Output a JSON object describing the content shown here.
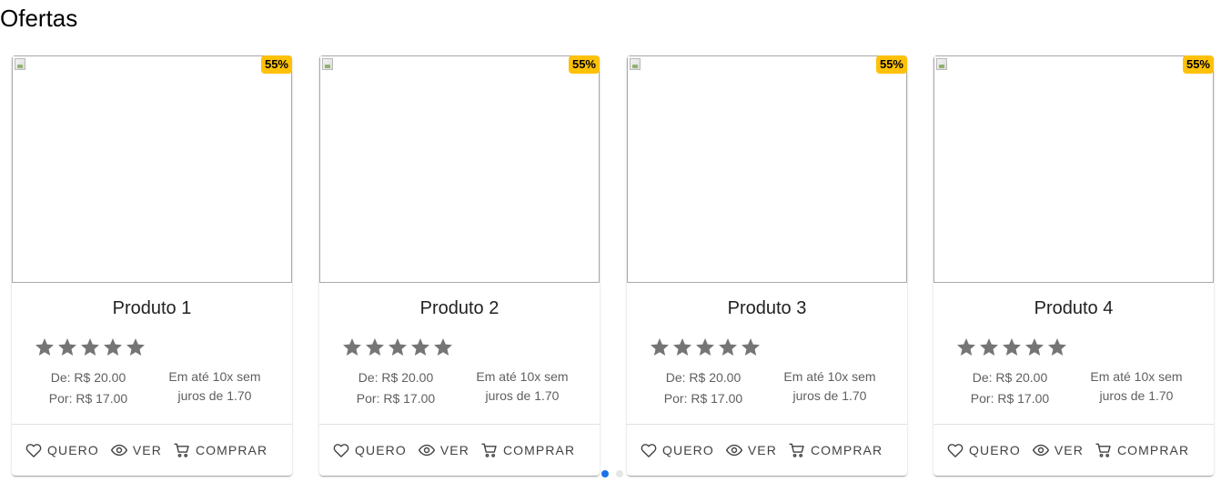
{
  "section": {
    "title": "Ofertas"
  },
  "products": [
    {
      "name": "Produto 1",
      "discount": "55%",
      "rating": 5,
      "price_from": "De: R$ 20.00",
      "price_now": "Por: R$ 17.00",
      "installments": "Em até 10x sem juros de 1.70"
    },
    {
      "name": "Produto 2",
      "discount": "55%",
      "rating": 5,
      "price_from": "De: R$ 20.00",
      "price_now": "Por: R$ 17.00",
      "installments": "Em até 10x sem juros de 1.70"
    },
    {
      "name": "Produto 3",
      "discount": "55%",
      "rating": 5,
      "price_from": "De: R$ 20.00",
      "price_now": "Por: R$ 17.00",
      "installments": "Em até 10x sem juros de 1.70"
    },
    {
      "name": "Produto 4",
      "discount": "55%",
      "rating": 5,
      "price_from": "De: R$ 20.00",
      "price_now": "Por: R$ 17.00",
      "installments": "Em até 10x sem juros de 1.70"
    }
  ],
  "actions": {
    "want_label": "QUERO",
    "view_label": "VER",
    "buy_label": "COMPRAR"
  },
  "icons": {
    "broken_image": "broken-image-icon",
    "star": "star-icon",
    "want": "heart-icon",
    "view": "eye-icon",
    "buy": "cart-icon"
  },
  "pager": {
    "pages": 2,
    "active": 1
  },
  "colors": {
    "discount_badge": "#ffc107",
    "star": "#757575",
    "pager_active": "#1a73e8",
    "pager_inactive": "#e6e6e6"
  }
}
